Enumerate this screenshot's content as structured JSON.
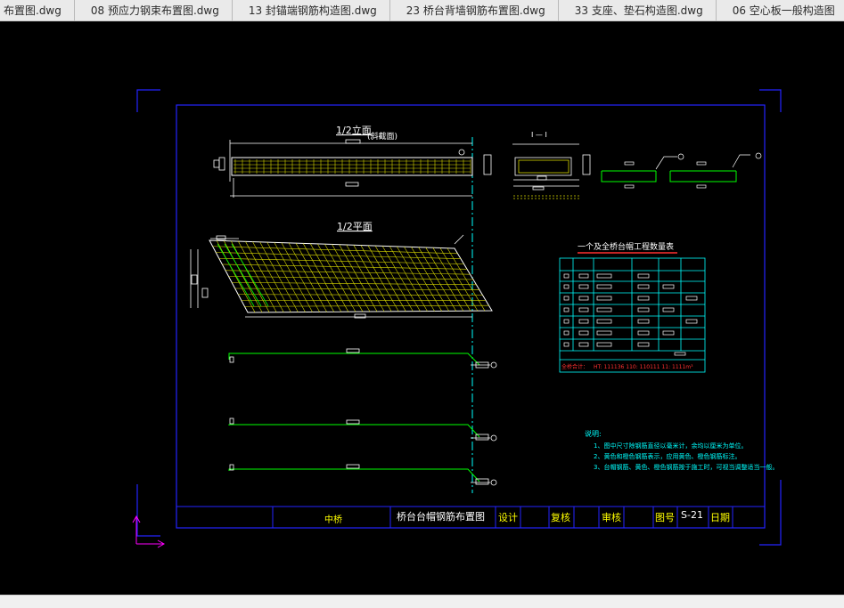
{
  "tabs": [
    {
      "label": "布置图.dwg"
    },
    {
      "label": "08 预应力钢束布置图.dwg"
    },
    {
      "label": "13 封锚端钢筋构造图.dwg"
    },
    {
      "label": "23 桥台背墙钢筋布置图.dwg"
    },
    {
      "label": "33 支座、垫石构造图.dwg"
    },
    {
      "label": "06 空心板一般构造图"
    }
  ],
  "drawing": {
    "elevation_title": "1/2立面",
    "elevation_note": "(斜截面)",
    "plan_title": "1/2平面",
    "section_label": "I — I",
    "table_title": "一个及全桥台帽工程数量表",
    "notes_heading": "说明:",
    "notes": [
      "1、图中尺寸除钢筋直径以毫米计，余均以厘米为单位。",
      "2、黄色和橙色钢筋表示，应用黄色、橙色钢筋标注。",
      "3、台帽钢筋、黄色、橙色钢筋按于施工时，可视当调整适当一般。"
    ],
    "table_bottom_row": "全桥合计：",
    "table_bottom_vals": "HT: 111136  110: 110111  11: 1111m³"
  },
  "title_block": {
    "project": "中桥",
    "drawing_name": "桥台台帽钢筋布置图",
    "design": "设计",
    "review": "复核",
    "audit": "审核",
    "drawing_no_label": "图号",
    "drawing_no": "S-21",
    "date_label": "日期"
  },
  "colors": {
    "background": "#000000",
    "frame": "#2323ff",
    "title_block_text": "#ffff00",
    "linework": "#ffffff",
    "grid": "#d8d800",
    "rebar_green": "#00ff00",
    "cyan": "#00ffff",
    "red": "#ff3030",
    "ucs_icon": "#ff00ff"
  }
}
